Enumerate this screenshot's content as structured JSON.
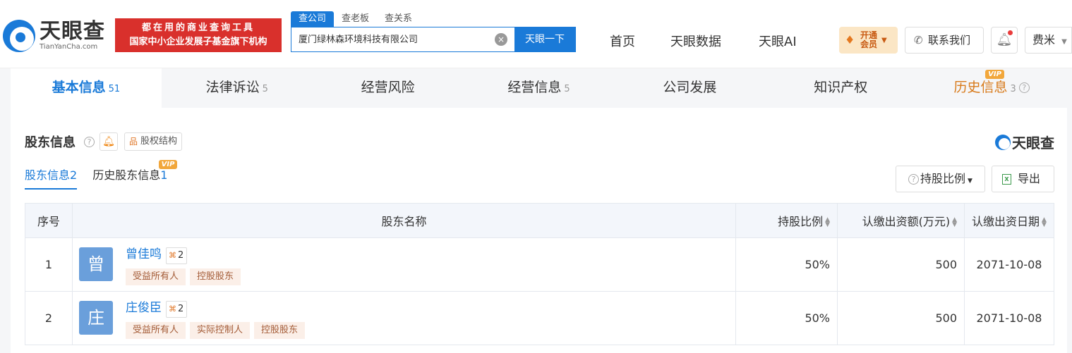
{
  "header": {
    "logo_cn": "天眼查",
    "logo_en": "TianYanCha.com",
    "ad_line1": "都在用的商业查询工具",
    "ad_line2": "国家中小企业发展子基金旗下机构",
    "search_tabs": [
      "查公司",
      "查老板",
      "查关系"
    ],
    "search_value": "厦门绿林森环境科技有限公司",
    "search_button": "天眼一下",
    "nav": [
      "首页",
      "天眼数据",
      "天眼AI"
    ],
    "vip_line1": "开通",
    "vip_line2": "会员",
    "contact": "联系我们",
    "user": "费米"
  },
  "main_tabs": [
    {
      "label": "基本信息",
      "count": "51"
    },
    {
      "label": "法律诉讼",
      "count": "5"
    },
    {
      "label": "经营风险",
      "count": ""
    },
    {
      "label": "经营信息",
      "count": "5"
    },
    {
      "label": "公司发展",
      "count": ""
    },
    {
      "label": "知识产权",
      "count": ""
    },
    {
      "label": "历史信息",
      "count": "3"
    }
  ],
  "vip_badge": "VIP",
  "section": {
    "title": "股东信息",
    "equity_label": "股权结构",
    "brand": "天眼查",
    "sub_tabs": [
      {
        "label": "股东信息",
        "count": "2"
      },
      {
        "label": "历史股东信息",
        "count": "1"
      }
    ],
    "ratio_button": "持股比例",
    "export_button": "导出"
  },
  "table": {
    "headers": [
      "序号",
      "股东名称",
      "持股比例",
      "认缴出资额(万元)",
      "认缴出资日期"
    ],
    "rows": [
      {
        "idx": "1",
        "avatar": "曾",
        "name": "曾佳鸣",
        "rel_count": "2",
        "tags": [
          "受益所有人",
          "控股股东"
        ],
        "ratio": "50%",
        "amount": "500",
        "date": "2071-10-08"
      },
      {
        "idx": "2",
        "avatar": "庄",
        "name": "庄俊臣",
        "rel_count": "2",
        "tags": [
          "受益所有人",
          "实际控制人",
          "控股股东"
        ],
        "ratio": "50%",
        "amount": "500",
        "date": "2071-10-08"
      }
    ]
  }
}
